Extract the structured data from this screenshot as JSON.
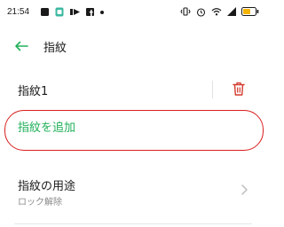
{
  "status_bar": {
    "time": "21:54",
    "left_icons": [
      "square-notification-icon",
      "clipboard-icon",
      "media-icon",
      "facebook-icon",
      "dot-icon"
    ],
    "right_icons": [
      "vibrate-icon",
      "alarm-icon",
      "wifi-icon",
      "signal-icon",
      "battery-icon"
    ]
  },
  "header": {
    "title": "指紋"
  },
  "fingerprint_item": {
    "name": "指紋1"
  },
  "add_fingerprint": {
    "label": "指紋を追加"
  },
  "usage": {
    "title": "指紋の用途",
    "subtitle": "ロック解除"
  },
  "colors": {
    "accent_green": "#22b05a",
    "delete_red": "#d33a2c",
    "annotation_red": "#d8201e"
  }
}
